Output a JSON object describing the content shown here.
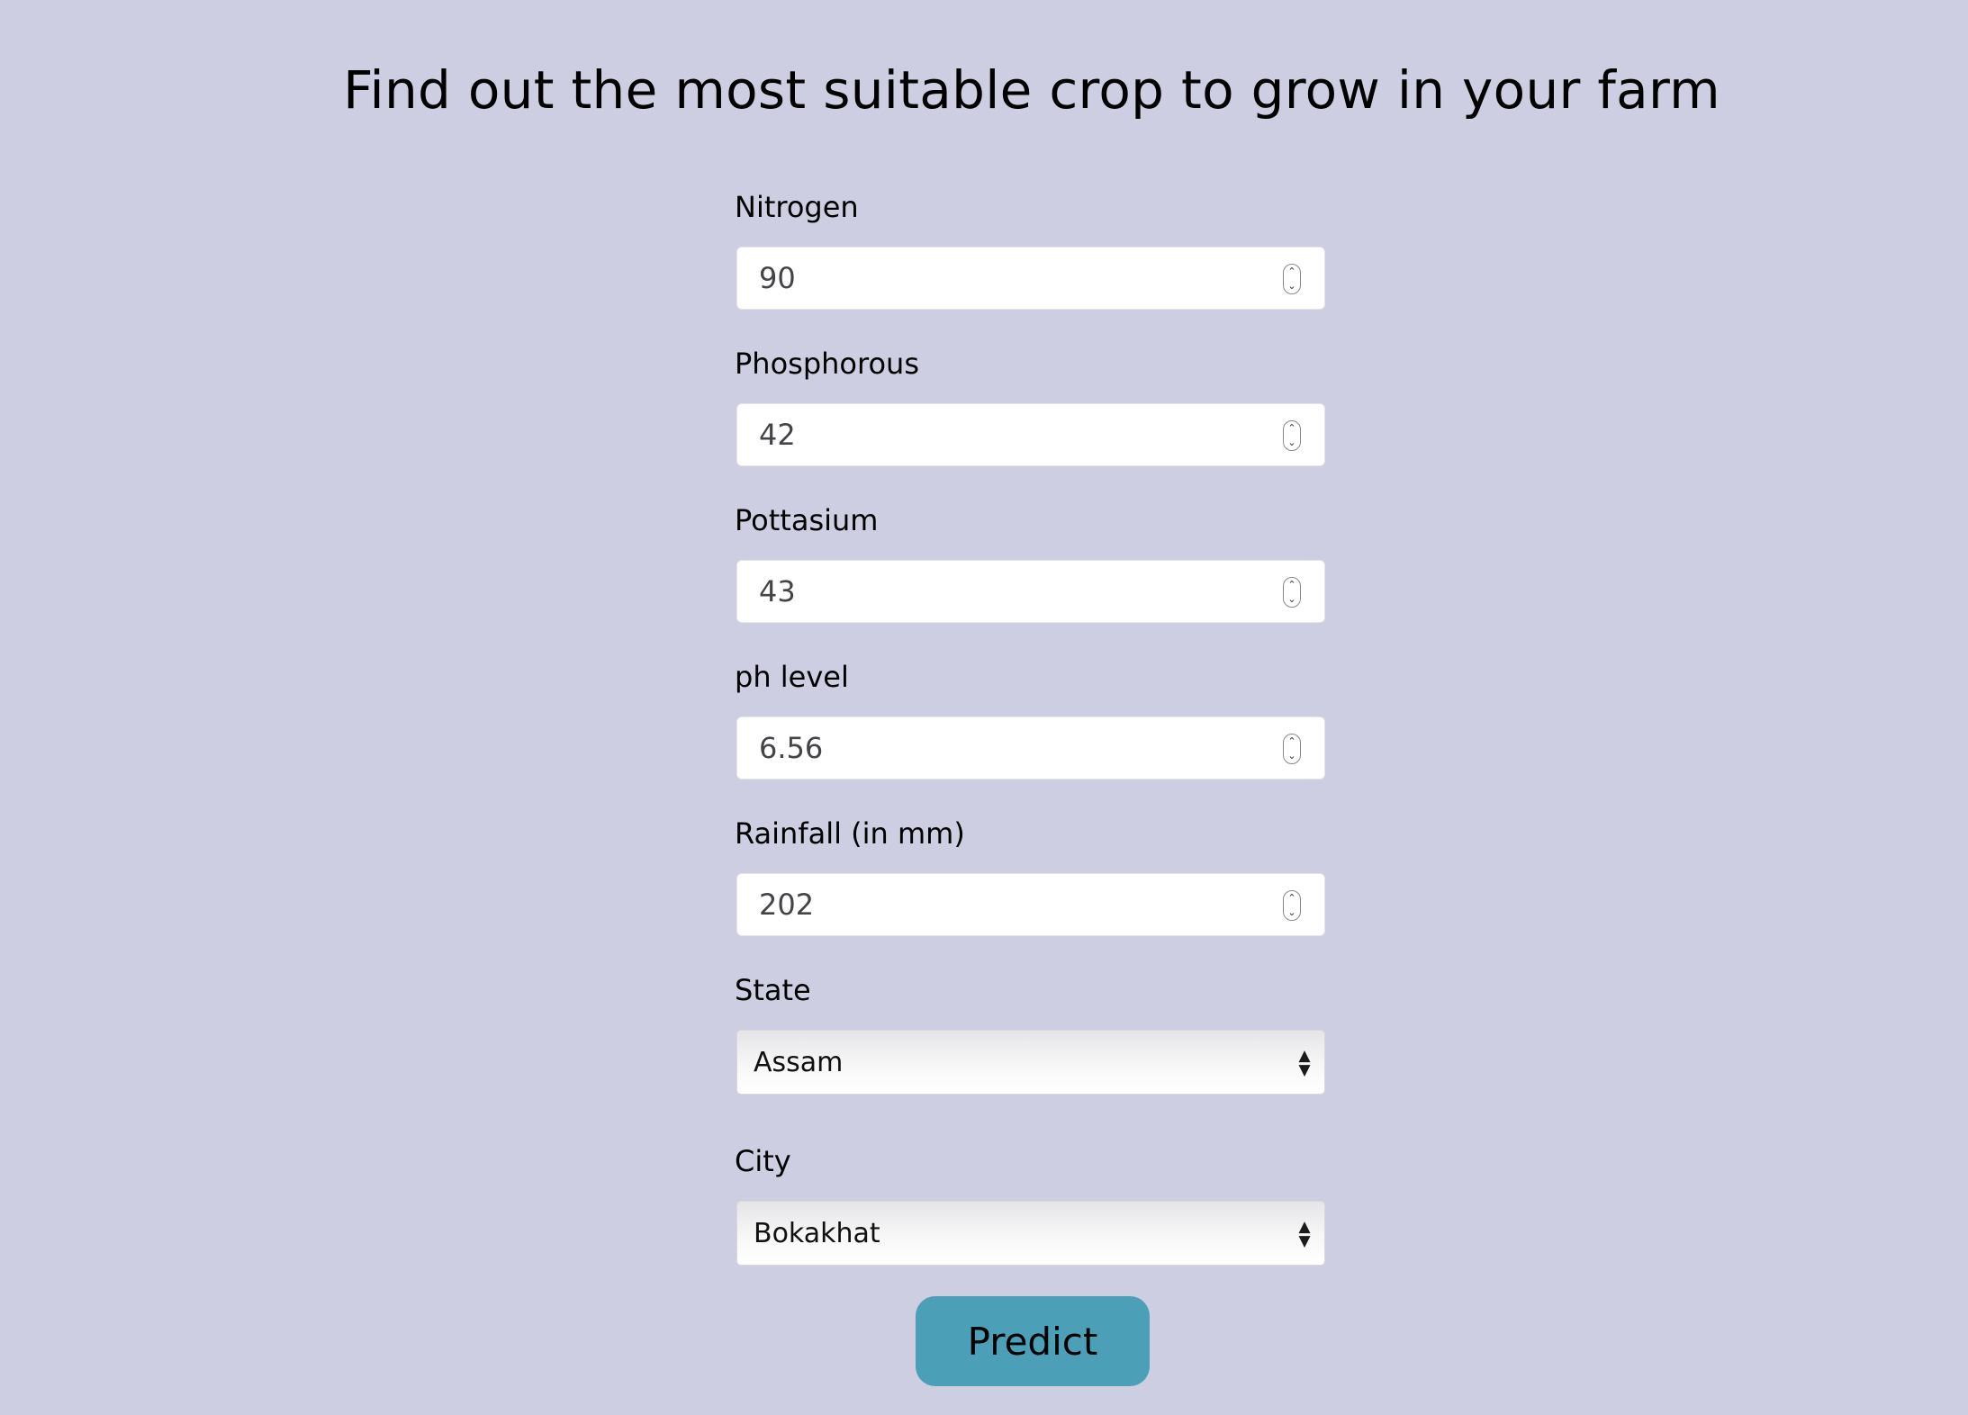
{
  "page": {
    "title": "Find out the most suitable crop to grow in your farm"
  },
  "form": {
    "nitrogen": {
      "label": "Nitrogen",
      "value": "90"
    },
    "phosphorous": {
      "label": "Phosphorous",
      "value": "42"
    },
    "pottasium": {
      "label": "Pottasium",
      "value": "43"
    },
    "ph": {
      "label": "ph level",
      "value": "6.56"
    },
    "rainfall": {
      "label": "Rainfall (in mm)",
      "value": "202"
    },
    "state": {
      "label": "State",
      "selected": "Assam"
    },
    "city": {
      "label": "City",
      "selected": "Bokakhat"
    },
    "submit_label": "Predict"
  },
  "theme": {
    "background": "#cdcee2",
    "button": "#4ba0b8"
  },
  "icons": {
    "number_spinner": "up-down-stepper-icon",
    "select_arrows": "select-updown-icon"
  }
}
